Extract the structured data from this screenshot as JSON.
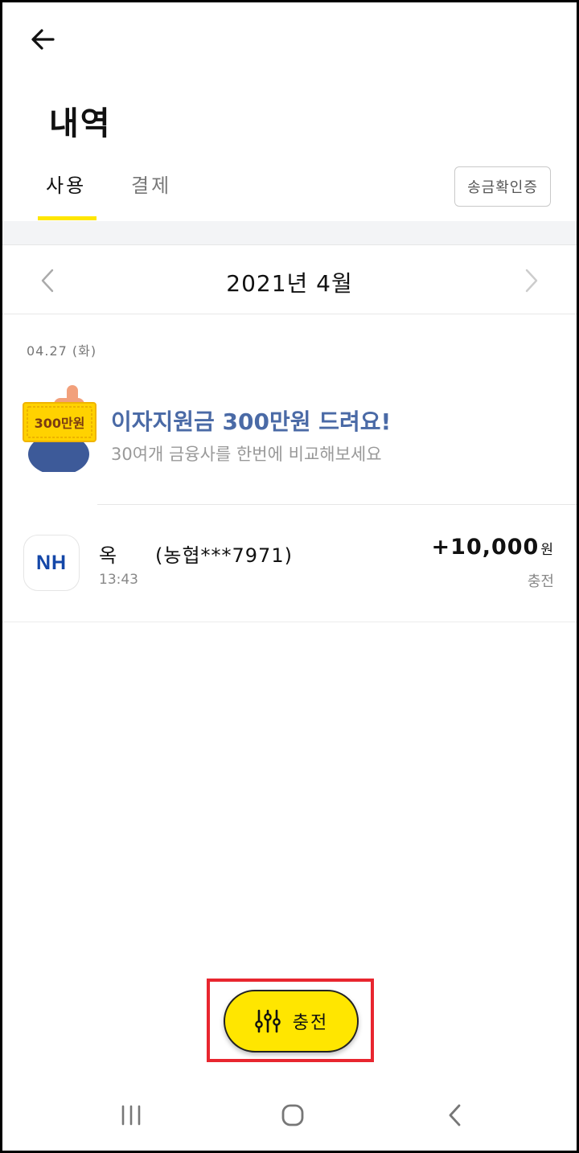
{
  "header": {
    "title": "내역"
  },
  "tabs": [
    {
      "label": "사용",
      "active": true
    },
    {
      "label": "결제",
      "active": false
    }
  ],
  "verify_button": {
    "label": "송금확인증"
  },
  "month_nav": {
    "label": "2021년 4월"
  },
  "date_group": {
    "label": "04.27 (화)"
  },
  "promo": {
    "badge": "300만원",
    "title": "이자지원금 300만원 드려요!",
    "subtitle": "30여개 금융사를 한번에 비교해보세요"
  },
  "transaction": {
    "bank_logo": "NH",
    "name": "옥",
    "account": "(농협***7971)",
    "time": "13:43",
    "amount": "+10,000",
    "unit": "원",
    "type": "충전"
  },
  "charge_button": {
    "label": "충전"
  },
  "colors": {
    "accent_yellow": "#ffe600",
    "promo_blue": "#4a6aa6",
    "nh_blue": "#1447a8",
    "highlight_red": "#e8262f"
  },
  "icons": {
    "back": "arrow-left-icon",
    "prev_month": "chevron-left-icon",
    "next_month": "chevron-right-icon",
    "charge": "sliders-icon",
    "nav_recents": "recents-icon",
    "nav_home": "home-icon",
    "nav_back": "nav-back-icon"
  }
}
